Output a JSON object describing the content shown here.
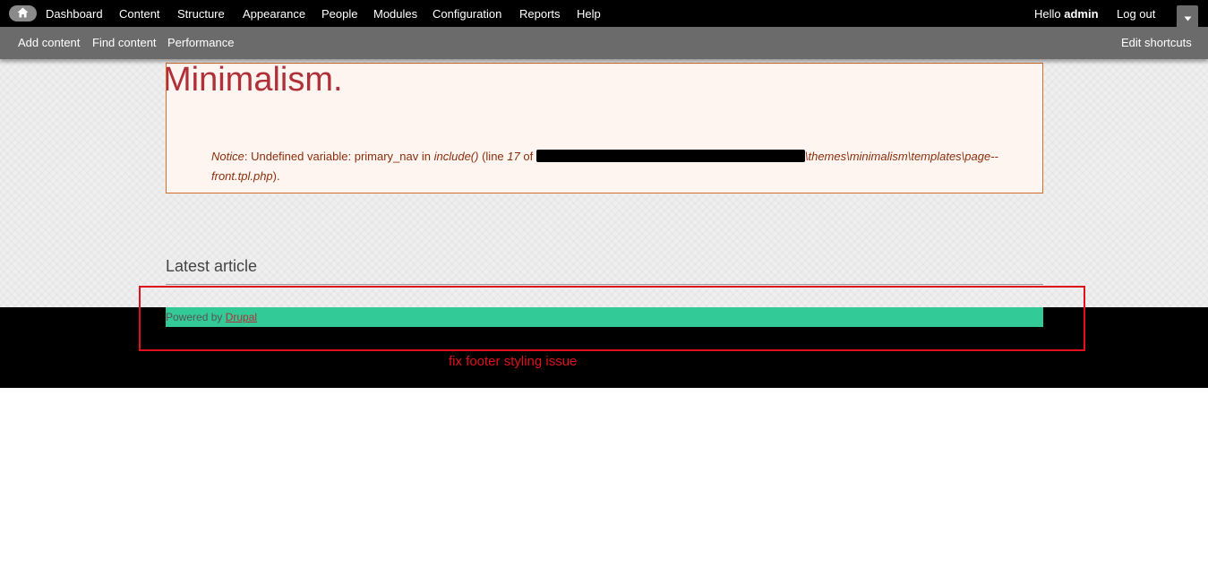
{
  "toolbar": {
    "home_icon": "home-icon",
    "menu": [
      {
        "label": "Dashboard"
      },
      {
        "label": "Content"
      },
      {
        "label": "Structure"
      },
      {
        "label": "Appearance"
      },
      {
        "label": "People"
      },
      {
        "label": "Modules"
      },
      {
        "label": "Configuration"
      },
      {
        "label": "Reports"
      },
      {
        "label": "Help"
      }
    ],
    "hello_prefix": "Hello",
    "user_name": "admin",
    "logout_label": "Log out",
    "drawer_icon": "chevron-down-icon"
  },
  "shortcuts": {
    "items": [
      {
        "label": "Add content"
      },
      {
        "label": "Find content"
      },
      {
        "label": "Performance"
      }
    ],
    "edit_label": "Edit shortcuts"
  },
  "content": {
    "site_title": "Minimalism.",
    "notice": {
      "type": "Notice",
      "message": "Undefined variable: primary_nav in",
      "function": "include()",
      "line_prefix": "(line",
      "line_number": "17",
      "of": "of",
      "path_redacted": "C:\\...",
      "path_suffix": "\\themes\\minimalism\\templates\\page--front.tpl.php",
      "closing": ")."
    },
    "section_title": "Latest article"
  },
  "footer": {
    "powered_prefix": "Powered by",
    "link_label": "Drupal"
  },
  "annotation": {
    "text": "fix footer styling issue"
  },
  "colors": {
    "toolbar_bg": "#000000",
    "shortcuts_bg": "#6b6b6b",
    "footer_bg": "#000000",
    "footer_bar": "#32cb97",
    "annotation": "#e0101e",
    "title": "#b0303a",
    "message_border": "#d36d2c",
    "message_bg": "#fef5f1"
  }
}
